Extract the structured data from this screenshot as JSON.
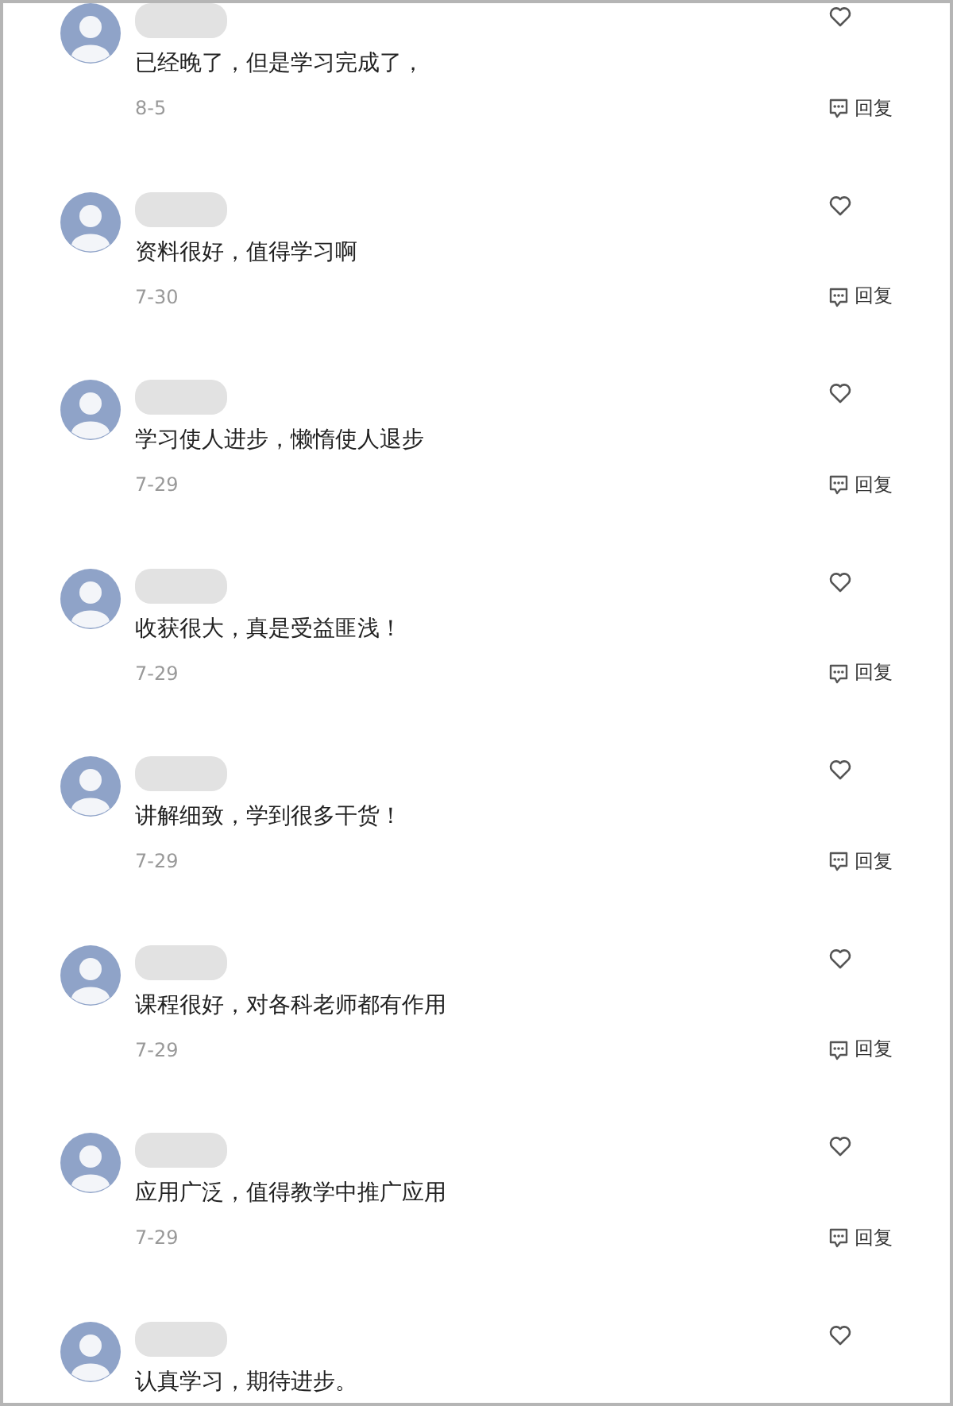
{
  "comments": [
    {
      "text": "已经晚了，但是学习完成了，",
      "date": "8-5",
      "reply": "回复"
    },
    {
      "text": "资料很好，值得学习啊",
      "date": "7-30",
      "reply": "回复"
    },
    {
      "text": "学习使人进步，懒惰使人退步",
      "date": "7-29",
      "reply": "回复"
    },
    {
      "text": "收获很大，真是受益匪浅！",
      "date": "7-29",
      "reply": "回复"
    },
    {
      "text": "讲解细致，学到很多干货！",
      "date": "7-29",
      "reply": "回复"
    },
    {
      "text": "课程很好，对各科老师都有作用",
      "date": "7-29",
      "reply": "回复"
    },
    {
      "text": "应用广泛，值得教学中推广应用",
      "date": "7-29",
      "reply": "回复"
    },
    {
      "text": "认真学习，期待进步。"
    }
  ]
}
